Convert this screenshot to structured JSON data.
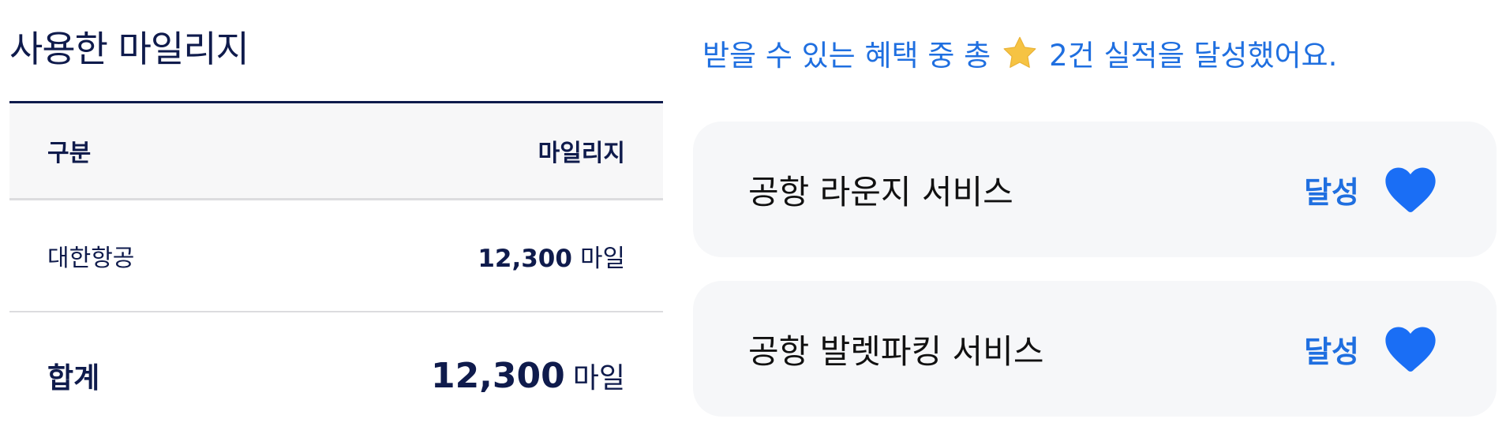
{
  "mileage_used": {
    "title": "사용한 마일리지",
    "table": {
      "col_category": "구분",
      "col_mileage": "마일리지",
      "rows": [
        {
          "label": "대한항공",
          "amount": "12,300",
          "unit": "마일"
        }
      ],
      "total": {
        "label": "합계",
        "amount": "12,300",
        "unit": "마일"
      }
    }
  },
  "benefits": {
    "summary_prefix": "받을 수 있는 혜택 중 총",
    "summary_icon": "star-icon",
    "summary_suffix": "2건 실적을 달성했어요.",
    "accent_color": "#1f6fe0",
    "items": [
      {
        "title": "공항 라운지 서비스",
        "status": "달성",
        "icon": "heart-icon"
      },
      {
        "title": "공항 발렛파킹 서비스",
        "status": "달성",
        "icon": "heart-icon"
      }
    ]
  }
}
